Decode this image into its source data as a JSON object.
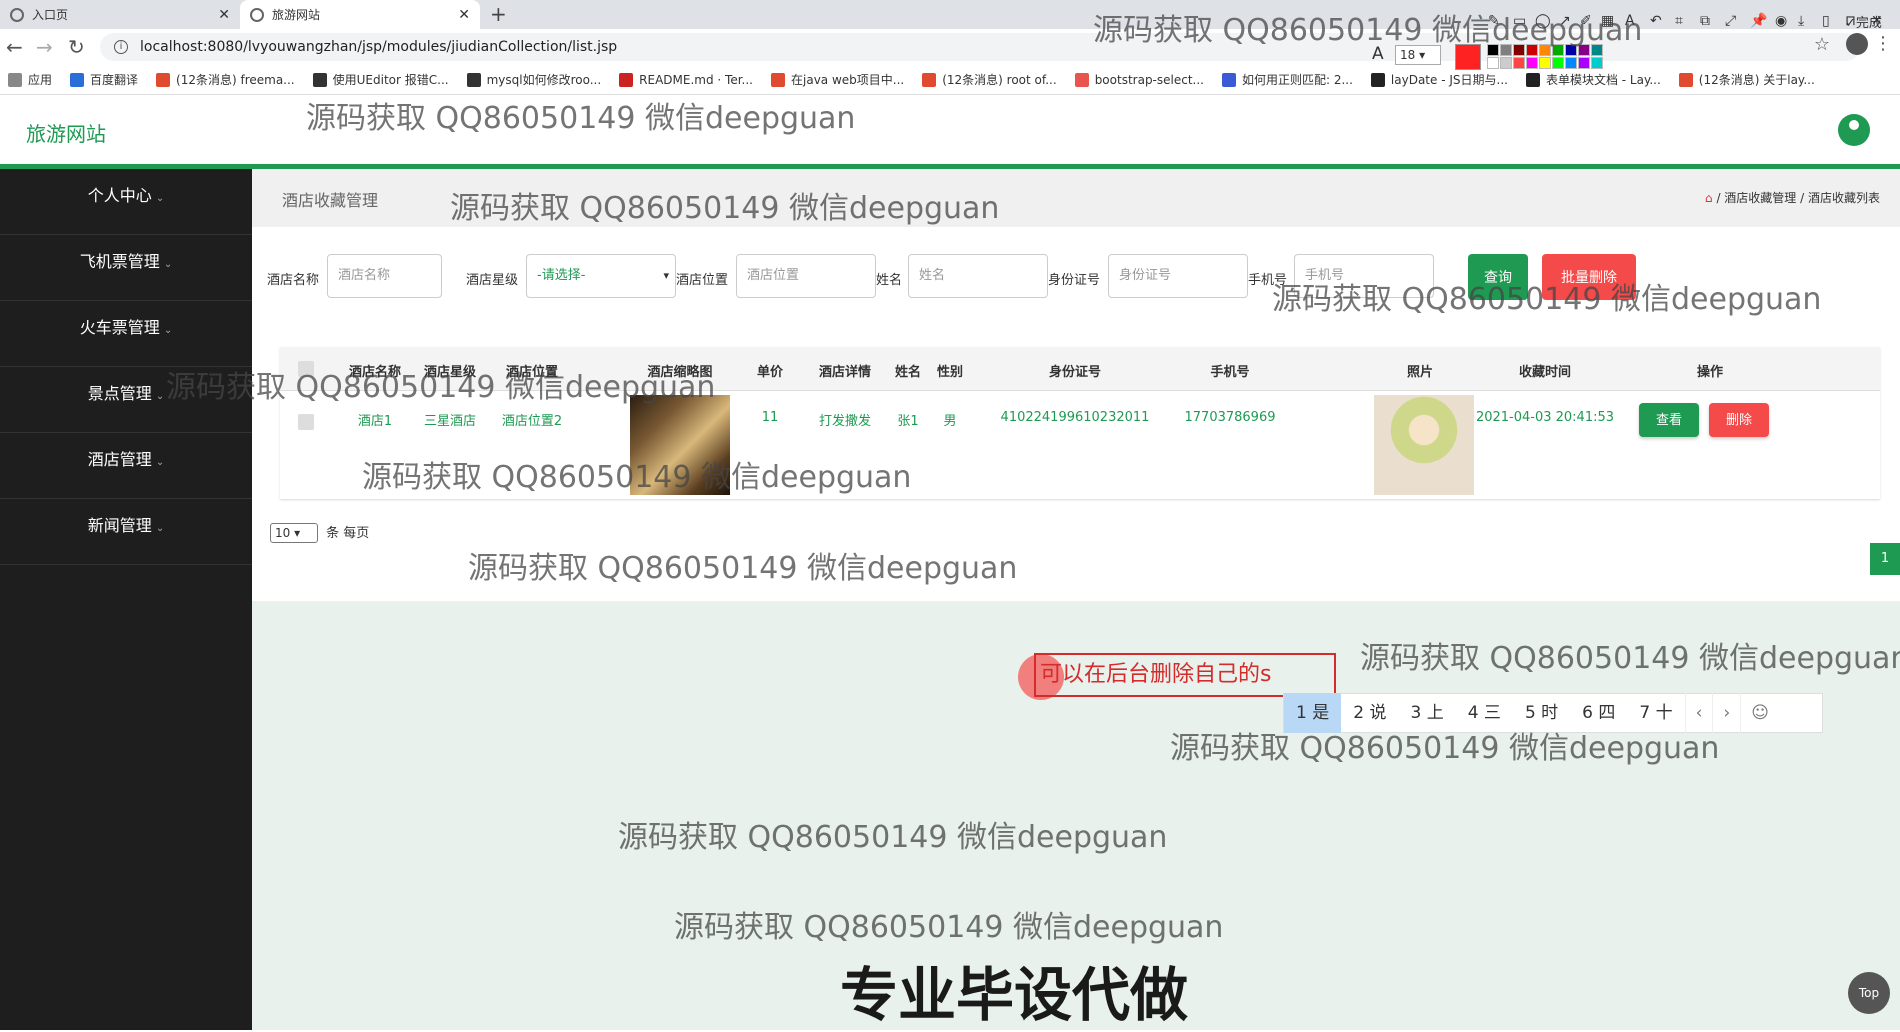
{
  "browser": {
    "tabs": [
      {
        "title": "入口页",
        "active": false
      },
      {
        "title": "旅游网站",
        "active": true
      }
    ],
    "new_tab_label": "+",
    "url": "localhost:8080/lvyouwangzhan/jsp/modules/jiudianCollection/list.jsp",
    "bookmarks": [
      "应用",
      "百度翻译",
      "(12条消息) freema...",
      "使用UEditor 报错C...",
      "mysql如何修改roo...",
      "README.md · Ter...",
      "在java web项目中...",
      "(12条消息) root of...",
      "bootstrap-select...",
      "如何用正则匹配: 2...",
      "layDate - JS日期与...",
      "表单模块文档 - Lay...",
      "(12条消息) 关于lay..."
    ]
  },
  "screenshot_tool": {
    "font_size": "18",
    "done_label": "完成",
    "accent_color": "#ff3333"
  },
  "header": {
    "logo": "旅游网站"
  },
  "sidebar": {
    "items": [
      {
        "label": "个人中心"
      },
      {
        "label": "飞机票管理"
      },
      {
        "label": "火车票管理"
      },
      {
        "label": "景点管理"
      },
      {
        "label": "酒店管理"
      },
      {
        "label": "新闻管理"
      }
    ]
  },
  "page": {
    "title": "酒店收藏管理",
    "breadcrumb": [
      "酒店收藏管理",
      "酒店收藏列表"
    ]
  },
  "search": {
    "fields": [
      {
        "label": "酒店名称",
        "placeholder": "酒店名称"
      },
      {
        "label": "酒店星级",
        "value": "-请选择-"
      },
      {
        "label": "酒店位置",
        "placeholder": "酒店位置"
      },
      {
        "label": "姓名",
        "placeholder": "姓名"
      },
      {
        "label": "身份证号",
        "placeholder": "身份证号"
      },
      {
        "label": "手机号",
        "placeholder": "手机号"
      }
    ],
    "query_button": "查询",
    "batch_delete_button": "批量删除"
  },
  "table": {
    "columns": [
      "酒店名称",
      "酒店星级",
      "酒店位置",
      "酒店缩略图",
      "单价",
      "酒店详情",
      "姓名",
      "性别",
      "身份证号",
      "手机号",
      "照片",
      "收藏时间",
      "操作"
    ],
    "rows": [
      {
        "name": "酒店1",
        "star": "三星酒店",
        "location": "酒店位置2",
        "price": "11",
        "detail": "打发撒发",
        "person": "张1",
        "gender": "男",
        "id_card": "410224199610232011",
        "phone": "17703786969",
        "time": "2021-04-03 20:41:53",
        "view_label": "查看",
        "delete_label": "删除"
      }
    ]
  },
  "pagination": {
    "page_size": "10",
    "suffix": "条 每页",
    "current_page": "1"
  },
  "ime": {
    "input_text": "可以在后台删除自己的s",
    "candidates": [
      "1 是",
      "2 说",
      "3 上",
      "4 三",
      "5 时",
      "6 四",
      "7 十"
    ],
    "emoji_icon": "☺"
  },
  "watermarks": {
    "text": "源码获取 QQ86050149 微信deepguan",
    "big_text": "专业毕设代做"
  },
  "top_button": "Top"
}
